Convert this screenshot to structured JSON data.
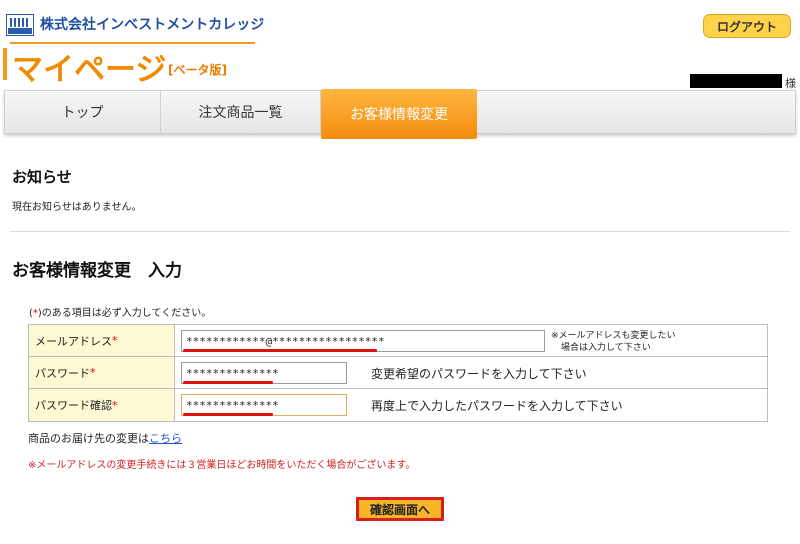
{
  "header": {
    "company": "株式会社インベストメントカレッジ",
    "page_title": "マイページ",
    "beta_badge": "[ベータ版]",
    "logout_label": "ログアウト",
    "honorific": "様"
  },
  "tabs": [
    {
      "label": "トップ",
      "active": false
    },
    {
      "label": "注文商品一覧",
      "active": false
    },
    {
      "label": "お客様情報変更",
      "active": true
    }
  ],
  "news": {
    "title": "お知らせ",
    "text": "現在お知らせはありません。"
  },
  "form": {
    "title": "お客様情報変更　入力",
    "required_prefix": "(",
    "required_mark": "*",
    "required_suffix": ")のある項目は必ず入力してください。",
    "fields": [
      {
        "label": "メールアドレス",
        "value": "************@*****************",
        "hint_line1": "※メールアドレスも変更したい",
        "hint_line2": "場合は入力して下さい"
      },
      {
        "label": "パスワード",
        "value": "**************",
        "hint": "変更希望のパスワードを入力して下さい"
      },
      {
        "label": "パスワード確認",
        "value": "**************",
        "hint": "再度上で入力したパスワードを入力して下さい"
      }
    ]
  },
  "delivery": {
    "text": "商品のお届け先の変更は",
    "link": "こちら"
  },
  "warning": "※メールアドレスの変更手続きには３営業日ほどお時間をいただく場合がございます。",
  "confirm_label": "確認画面へ",
  "colors": {
    "accent_orange": "#f08a00",
    "brand_blue": "#1f4fa3",
    "required_red": "#e00000",
    "label_bg": "#fdf9d4"
  }
}
